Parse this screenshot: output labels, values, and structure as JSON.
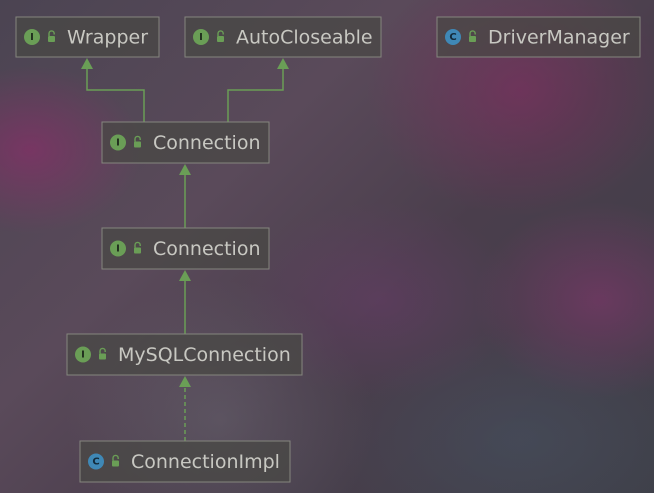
{
  "nodes": [
    {
      "id": "wrapper",
      "label": "Wrapper",
      "kind": "I"
    },
    {
      "id": "autocloseable",
      "label": "AutoCloseable",
      "kind": "I"
    },
    {
      "id": "drivermanager",
      "label": "DriverManager",
      "kind": "C"
    },
    {
      "id": "connection-sql",
      "label": "Connection",
      "kind": "I"
    },
    {
      "id": "connection-jdbc",
      "label": "Connection",
      "kind": "I"
    },
    {
      "id": "mysqlconnection",
      "label": "MySQLConnection",
      "kind": "I"
    },
    {
      "id": "connectionimpl",
      "label": "ConnectionImpl",
      "kind": "C"
    }
  ],
  "edges": [
    {
      "from": "connection-sql",
      "to": "wrapper",
      "style": "solid"
    },
    {
      "from": "connection-sql",
      "to": "autocloseable",
      "style": "solid"
    },
    {
      "from": "connection-jdbc",
      "to": "connection-sql",
      "style": "solid"
    },
    {
      "from": "mysqlconnection",
      "to": "connection-jdbc",
      "style": "solid"
    },
    {
      "from": "connectionimpl",
      "to": "mysqlconnection",
      "style": "dashed"
    }
  ],
  "colors": {
    "interface_badge": "#6a9e56",
    "class_badge": "#3f88b6",
    "edge": "#6a9e56"
  },
  "icons": {
    "interface": "interface-icon",
    "class": "class-icon",
    "visibility": "public-lock-icon"
  }
}
